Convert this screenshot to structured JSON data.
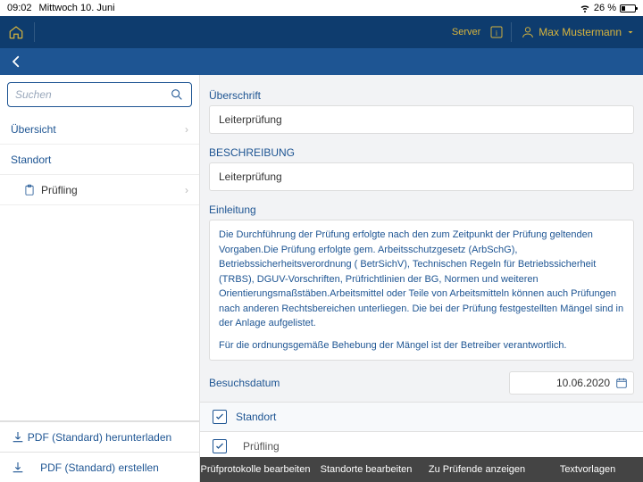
{
  "status": {
    "time": "09:02",
    "date": "Mittwoch 10. Juni",
    "battery": "26 %"
  },
  "topbar": {
    "server": "Server",
    "user": "Max Mustermann"
  },
  "sidebar": {
    "searchPlaceholder": "Suchen",
    "items": [
      {
        "label": "Übersicht"
      },
      {
        "label": "Standort"
      },
      {
        "label": "Prüfling"
      }
    ],
    "pdf1": "PDF (Standard) herunterladen",
    "pdf2": "PDF (Standard) erstellen"
  },
  "form": {
    "ueberschrift_label": "Überschrift",
    "ueberschrift_value": "Leiterprüfung",
    "beschreibung_label": "BESCHREIBUNG",
    "beschreibung_value": "Leiterprüfung",
    "einleitung_label": "Einleitung",
    "einleitung_p1": "Die Durchführung der Prüfung erfolgte nach den zum Zeitpunkt der Prüfung geltenden Vorgaben.Die Prüfung erfolgte gem. Arbeitsschutzgesetz (ArbSchG), Betriebssicherheitsverordnung ( BetrSichV), Technischen Regeln für Betriebssicherheit (TRBS), DGUV-Vorschriften, Prüfrichtlinien der BG, Normen und weiteren Orientierungsmaßstäben.Arbeitsmittel oder Teile von Arbeitsmitteln können auch Prüfungen nach anderen Rechtsbereichen unterliegen. Die bei der Prüfung festgestellten Mängel sind in der Anlage aufgelistet.",
    "einleitung_p2": "Für die ordnungsgemäße Behebung der Mängel ist der Betreiber verantwortlich.",
    "besuchsdatum_label": "Besuchsdatum",
    "besuchsdatum_value": "10.06.2020",
    "check_standort": "Standort",
    "check_pruefling": "Prüfling"
  },
  "bottom": {
    "b1": "Prüfprotokolle bearbeiten",
    "b2": "Standorte bearbeiten",
    "b3": "Zu Prüfende anzeigen",
    "b4": "Textvorlagen"
  }
}
